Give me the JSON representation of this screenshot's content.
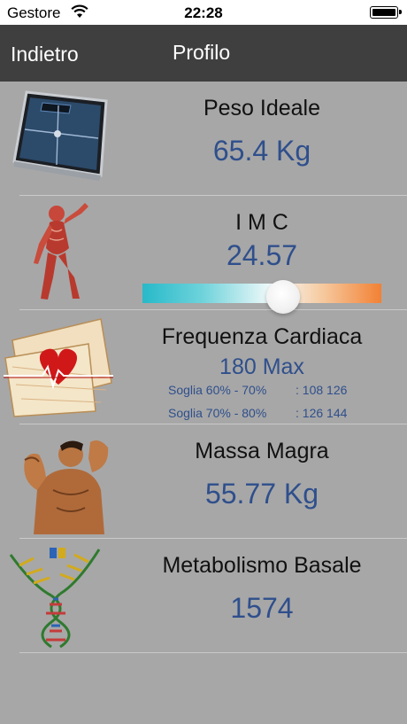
{
  "status_bar": {
    "carrier": "Gestore",
    "time": "22:28"
  },
  "nav": {
    "back_label": "Indietro",
    "title": "Profilo"
  },
  "rows": {
    "peso": {
      "label": "Peso Ideale",
      "value": "65.4 Kg",
      "icon": "scale-icon"
    },
    "imc": {
      "label": "I M C",
      "value": "24.57",
      "slider_fraction": 0.59,
      "icon": "anatomy-figure-icon"
    },
    "cardiaca": {
      "label": "Frequenza Cardiaca",
      "value": "180 Max",
      "zone1_label": "Soglia 60% - 70%",
      "zone1_value": ": 108 126",
      "zone2_label": "Soglia 70% - 80%",
      "zone2_value": ": 126 144",
      "icon": "heart-ecg-icon"
    },
    "massa": {
      "label": "Massa Magra",
      "value": "55.77 Kg",
      "icon": "muscle-man-icon"
    },
    "metabolismo": {
      "label": "Metabolismo Basale",
      "value": "1574",
      "icon": "dna-helix-icon"
    }
  },
  "colors": {
    "accent": "#2f4f8c",
    "navbar": "#3f3f3f",
    "background": "#a7a7a7"
  }
}
